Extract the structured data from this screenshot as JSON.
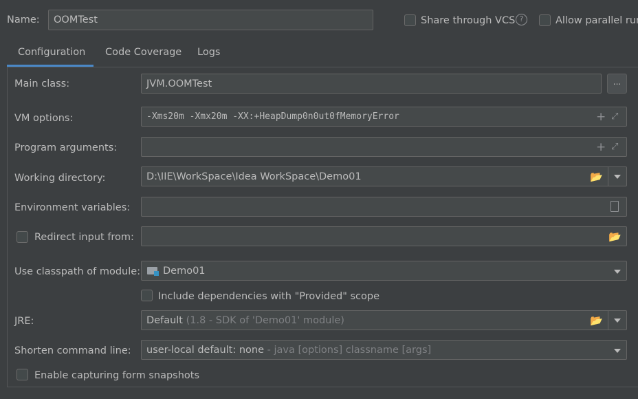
{
  "header": {
    "name_label": "Name:",
    "name_value": "OOMTest",
    "share_vcs_label": "Share through VCS",
    "share_vcs_checked": false,
    "allow_parallel_label": "Allow parallel run",
    "allow_parallel_checked": false
  },
  "tabs": [
    {
      "label": "Configuration",
      "active": true
    },
    {
      "label": "Code Coverage",
      "active": false
    },
    {
      "label": "Logs",
      "active": false
    }
  ],
  "form": {
    "main_class_label": "Main class:",
    "main_class_value": "JVM.OOMTest",
    "browse_label": "...",
    "vm_options_label": "VM options:",
    "vm_options_value": "-Xms20m -Xmx20m -XX:+HeapDump0n0ut0fMemoryError",
    "program_args_label": "Program arguments:",
    "program_args_value": "",
    "working_dir_label": "Working directory:",
    "working_dir_value": "D:\\IIE\\WorkSpace\\Idea WorkSpace\\Demo01",
    "env_vars_label": "Environment variables:",
    "env_vars_value": "",
    "redirect_input_label": "Redirect input from:",
    "redirect_input_checked": false,
    "redirect_input_value": "",
    "classpath_label": "Use classpath of module:",
    "classpath_value": "Demo01",
    "include_deps_label": "Include dependencies with \"Provided\" scope",
    "include_deps_checked": false,
    "jre_label": "JRE:",
    "jre_value": "Default",
    "jre_hint": "(1.8 - SDK of 'Demo01' module)",
    "shorten_label": "Shorten command line:",
    "shorten_value": "user-local default: none",
    "shorten_hint": "- java [options] classname [args]",
    "snapshots_label": "Enable capturing form snapshots",
    "snapshots_checked": false
  },
  "colors": {
    "background": "#3c3f41",
    "field_bg": "#45494a",
    "tab_underline": "#4a88c7",
    "text": "#bbbbbb",
    "hint": "#7f8184"
  }
}
